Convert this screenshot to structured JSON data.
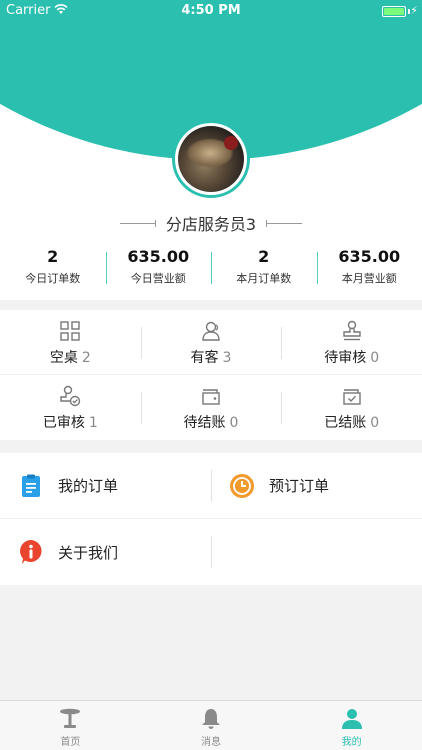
{
  "status_bar": {
    "carrier": "Carrier",
    "time": "4:50 PM"
  },
  "user": {
    "name": "分店服务员3"
  },
  "stats": [
    {
      "value": "2",
      "label": "今日订单数"
    },
    {
      "value": "635.00",
      "label": "今日营业额"
    },
    {
      "value": "2",
      "label": "本月订单数"
    },
    {
      "value": "635.00",
      "label": "本月营业额"
    }
  ],
  "table_status": [
    {
      "label": "空桌",
      "count": "2"
    },
    {
      "label": "有客",
      "count": "3"
    },
    {
      "label": "待审核",
      "count": "0"
    },
    {
      "label": "已审核",
      "count": "1"
    },
    {
      "label": "待结账",
      "count": "0"
    },
    {
      "label": "已结账",
      "count": "0"
    }
  ],
  "menu": [
    {
      "label": "我的订单",
      "icon": "clipboard-icon",
      "color": "#2aa0e8"
    },
    {
      "label": "预订订单",
      "icon": "clock-icon",
      "color": "#f29a2e"
    },
    {
      "label": "关于我们",
      "icon": "info-icon",
      "color": "#e8442e"
    }
  ],
  "tabbar": [
    {
      "label": "首页",
      "icon": "table-icon",
      "active": false
    },
    {
      "label": "消息",
      "icon": "bell-icon",
      "active": false
    },
    {
      "label": "我的",
      "icon": "person-icon",
      "active": true
    }
  ],
  "colors": {
    "accent": "#2bbfb0",
    "text_muted": "#888888"
  }
}
